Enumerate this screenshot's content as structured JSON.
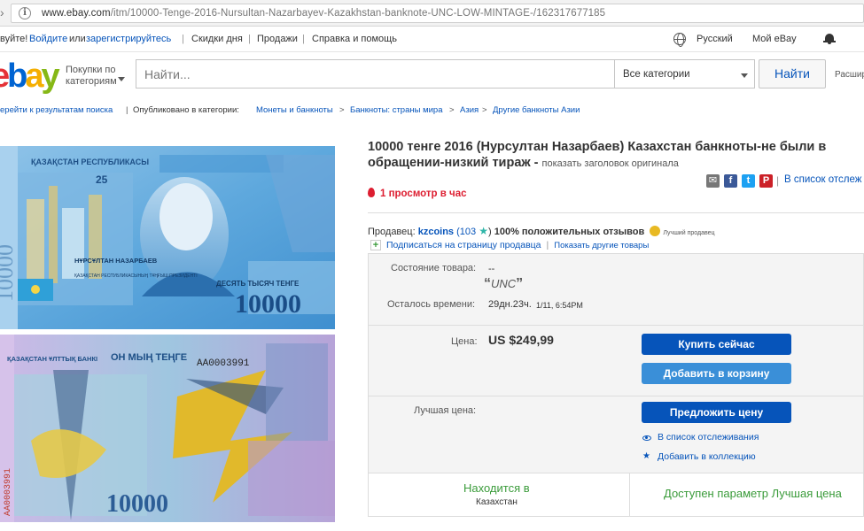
{
  "browser": {
    "url_host": "www.ebay.com",
    "url_path": "/itm/10000-Tenge-2016-Nursultan-Nazarbayev-Kazakhstan-banknote-UNC-LOW-MINTAGE-/162317677185"
  },
  "global_header": {
    "greeting": "вуйте!",
    "signin": "Войдите",
    "or": "или",
    "register": "зарегистрируйтесь",
    "deals": "Скидки дня",
    "sell": "Продажи",
    "help": "Справка и помощь",
    "language": "Русский",
    "my_ebay": "Мой eBay"
  },
  "search": {
    "shop_by_category": "Покупки по категориям",
    "placeholder": "Найти...",
    "category": "Все категории",
    "button": "Найти",
    "advanced": "Расшир"
  },
  "breadcrumb": {
    "back": "ерейти к результатам поиска",
    "listed_in": "Опубликовано в категории:",
    "items": [
      "Монеты и банкноты",
      "Банкноты: страны мира",
      "Азия",
      "Другие банкноты Азии"
    ]
  },
  "listing": {
    "title_line1": "10000 тенге 2016 (Нурсултан Назарбаев) Казахстан банкноты-не были в",
    "title_line2": "обращении-низкий тираж -",
    "show_original": "показать заголовок оригинала",
    "add_to_watchlist": "В список отслеж",
    "views": "1 просмотр в час"
  },
  "seller": {
    "label": "Продавец:",
    "name": "kzcoins",
    "score": "(103",
    "positive": "100% положительных отзывов",
    "top_seller": "Лучший продавец",
    "follow": "Подписаться на страницу продавца",
    "other_items": "Показать другие товары"
  },
  "buybox": {
    "condition_label": "Состояние товара:",
    "condition_value": "--",
    "condition_note": "UNC",
    "time_left_label": "Осталось времени:",
    "time_left_value": "29дн.23ч.",
    "time_left_date": "1/11, 6:54PM",
    "price_label": "Цена:",
    "price": "US $249,99",
    "buy_now": "Купить сейчас",
    "add_to_cart": "Добавить в корзину",
    "best_offer_label": "Лучшая цена:",
    "make_offer": "Предложить цену",
    "watch": "В список отслеживания",
    "add_collection": "Добавить в коллекцию",
    "located_in": "Находится в",
    "location": "Казахстан",
    "best_offer_available": "Доступен параметр Лучшая цена"
  },
  "banknote": {
    "front_texts": [
      "ҚАЗАҚСТАН РЕСПУБЛИКАСЫ",
      "25",
      "НҰРСҰЛТАН НАЗАРБАЕВ",
      "ҚАЗАҚСТАН РЕСПУБЛИКАСЫНЫҢ ТҰҢҒЫШ ПРЕЗИДЕНТІ",
      "ДЕСЯТЬ ТЫСЯЧ ТЕНГЕ",
      "10000",
      "10000"
    ],
    "back_texts": [
      "ҚАЗАҚСТАН ҰЛТТЫҚ БАНКІ",
      "ОН МЫҢ ТЕҢГЕ",
      "АА0003991",
      "10000",
      "АА0003991"
    ]
  },
  "colors": {
    "ebay_blue": "#0654ba",
    "price_red": "#dd1e31",
    "green": "#3a9b3a"
  }
}
